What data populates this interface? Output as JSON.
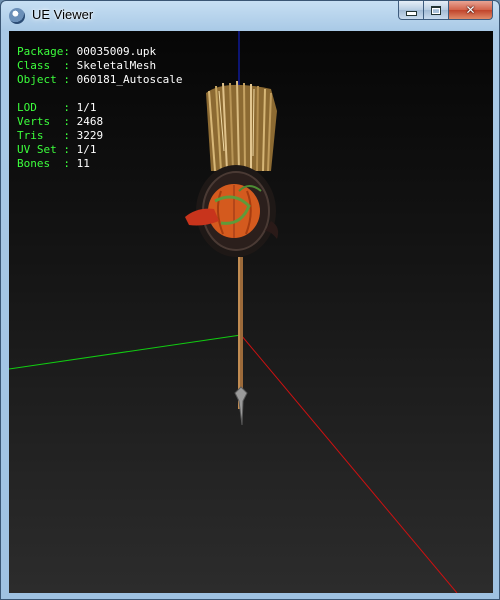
{
  "window": {
    "title": "UE Viewer",
    "controls": {
      "minimize": "—",
      "maximize": "□",
      "close": "✕"
    }
  },
  "info": {
    "package_label": "Package",
    "package": "00035009.upk",
    "class_label": "Class",
    "class": "SkeletalMesh",
    "object_label": "Object",
    "object": "060181_Autoscale",
    "lod_label": "LOD",
    "lod": "1/1",
    "verts_label": "Verts",
    "verts": "2468",
    "tris_label": "Tris",
    "tris": "3229",
    "uvset_label": "UV Set",
    "uvset": "1/1",
    "bones_label": "Bones",
    "bones": "11",
    "separator": ": "
  },
  "colors": {
    "label_green": "#3cff3c",
    "value_white": "#ffffff",
    "axis_x": "#cc1111",
    "axis_y": "#11cc11",
    "axis_z": "#1122dd"
  },
  "icons": {
    "app": "ue-viewer-app-icon",
    "mesh": "broom-staff-mesh"
  }
}
